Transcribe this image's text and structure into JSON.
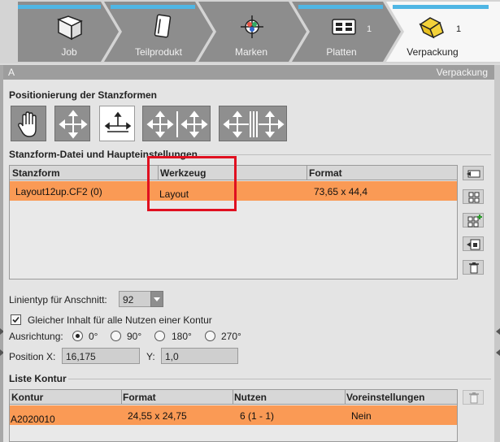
{
  "workflow_tabs": [
    {
      "label": "Job",
      "count": "",
      "icon": "book-icon",
      "active": false
    },
    {
      "label": "Teilprodukt",
      "count": "",
      "icon": "document-icon",
      "active": false
    },
    {
      "label": "Marken",
      "count": "",
      "icon": "register-mark-icon",
      "active": false
    },
    {
      "label": "Platten",
      "count": "1",
      "icon": "plates-icon",
      "active": false
    },
    {
      "label": "Verpackung",
      "count": "1",
      "icon": "packaging-icon",
      "active": true
    }
  ],
  "panel": {
    "left_title": "A",
    "right_title": "Verpackung"
  },
  "positioning": {
    "title": "Positionierung der Stanzformen",
    "buttons": [
      {
        "icon": "hand-icon",
        "selected": false
      },
      {
        "icon": "move-arrows-icon",
        "selected": false
      },
      {
        "icon": "align-bottom-icon",
        "selected": true
      },
      {
        "icon": "move-split-icon",
        "selected": false
      },
      {
        "icon": "mirror-split-icon",
        "selected": false
      }
    ]
  },
  "die_file": {
    "title": "Stanzform-Datei und Haupteinstellungen",
    "columns": [
      "Stanzform",
      "Werkzeug",
      "Format"
    ],
    "rows": [
      {
        "stanzform": "Layout12up.CF2 (0)",
        "werkzeug": "Layout",
        "format": "73,65 x 44,4"
      }
    ],
    "side_icons": [
      "import-icon",
      "grid-icon",
      "grid-add-icon",
      "export-icon",
      "trash-icon"
    ]
  },
  "form": {
    "line_type_label": "Linientyp für Anschnitt:",
    "line_type_value": "92",
    "same_content_label": "Gleicher Inhalt für alle Nutzen einer Kontur",
    "same_content_checked": true,
    "orientation_label": "Ausrichtung:",
    "orientation_options": [
      "0°",
      "90°",
      "180°",
      "270°"
    ],
    "orientation_selected": "0°",
    "position_x_label": "Position X:",
    "position_x_value": "16,175",
    "position_y_label": "Y:",
    "position_y_value": "1,0"
  },
  "contour_list": {
    "title": "Liste Kontur",
    "columns": [
      "Kontur",
      "Format",
      "Nutzen",
      "Voreinstellungen"
    ],
    "rows": [
      {
        "kontur": "A2020010",
        "format": "24,55 x 24,75",
        "nutzen": "6 (1 - 1)",
        "voreinstellungen": "Nein"
      }
    ]
  },
  "colors": {
    "accent_blue": "#4fb6e4",
    "row_highlight": "#fa9a55",
    "annotation_red": "#e01020"
  }
}
